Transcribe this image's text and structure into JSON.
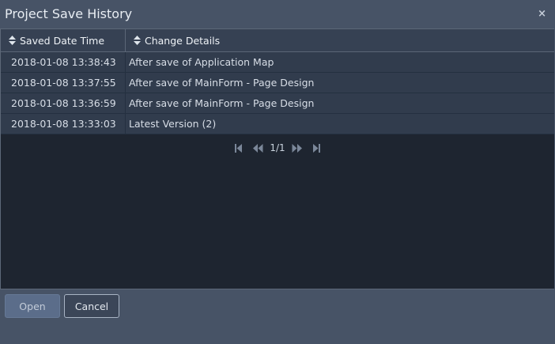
{
  "dialog": {
    "title": "Project Save History",
    "close_glyph": "×"
  },
  "table": {
    "columns": [
      "Saved Date Time",
      "Change Details"
    ],
    "rows": [
      [
        "2018-01-08 13:38:43",
        "After save of Application Map"
      ],
      [
        "2018-01-08 13:37:55",
        "After save of MainForm - Page Design"
      ],
      [
        "2018-01-08 13:36:59",
        "After save of MainForm - Page Design"
      ],
      [
        "2018-01-08 13:33:03",
        "Latest Version (2)"
      ]
    ]
  },
  "pager": {
    "page_text": "1/1",
    "icons": [
      "first-page-icon",
      "previous-page-icon",
      "next-page-icon",
      "last-page-icon"
    ]
  },
  "buttons": {
    "open_label": "Open",
    "cancel_label": "Cancel"
  }
}
